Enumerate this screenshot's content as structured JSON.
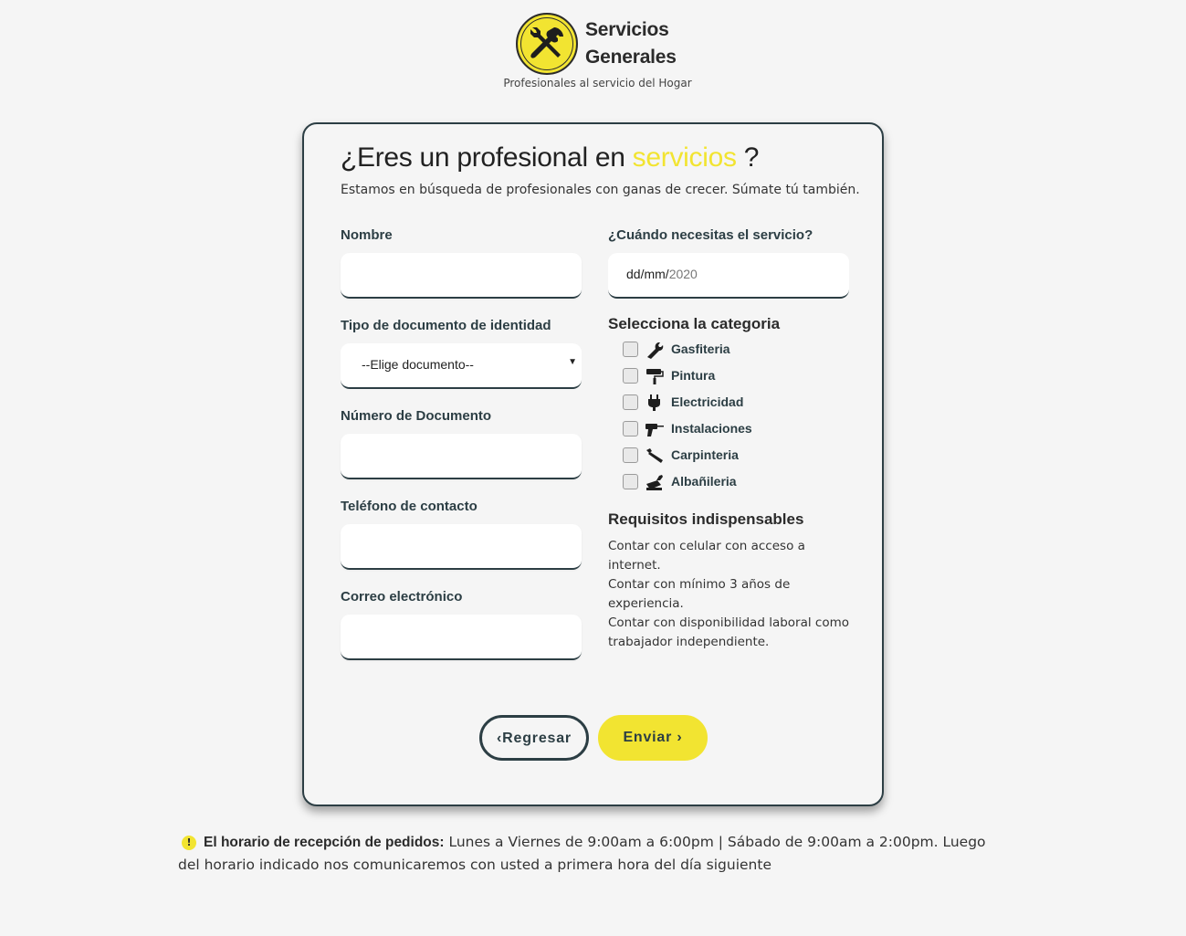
{
  "header": {
    "brand_line1": "Servicios",
    "brand_line2": "Generales",
    "tagline": "Profesionales al servicio del Hogar",
    "logo_icon": "tools-icon"
  },
  "form": {
    "title_prefix": "¿Eres un profesional en",
    "title_highlight": "servicios",
    "title_suffix": "?",
    "subtitle": "Estamos en búsqueda de profesionales con ganas de crecer. Súmate tú también.",
    "fields": {
      "nombre": {
        "label": "Nombre",
        "value": ""
      },
      "tipo_documento": {
        "label": "Tipo de documento de identidad",
        "selected": "--Elige documento--"
      },
      "numero_documento": {
        "label": "Número de Documento",
        "value": ""
      },
      "telefono": {
        "label": "Teléfono de contacto",
        "value": ""
      },
      "correo": {
        "label": "Correo electrónico",
        "value": ""
      },
      "fecha": {
        "label": "¿Cuándo necesitas el servicio?",
        "placeholder": "dd/mm/",
        "year": "2020"
      }
    },
    "categories_heading": "Selecciona la categoria",
    "categories": [
      {
        "label": "Gasfiteria",
        "icon": "wrench-icon",
        "checked": false
      },
      {
        "label": "Pintura",
        "icon": "paint-roller-icon",
        "checked": false
      },
      {
        "label": "Electricidad",
        "icon": "plug-icon",
        "checked": false
      },
      {
        "label": "Instalaciones",
        "icon": "drill-icon",
        "checked": false
      },
      {
        "label": "Carpinteria",
        "icon": "saw-icon",
        "checked": false
      },
      {
        "label": "Albañileria",
        "icon": "trowel-icon",
        "checked": false
      }
    ],
    "requirements_heading": "Requisitos indispensables",
    "requirements": [
      "Contar con celular con acceso a internet.",
      "Contar con mínimo 3 años de experiencia.",
      "Contar con disponibilidad laboral como trabajador independiente."
    ],
    "back_button": "Regresar",
    "send_button": "Enviar"
  },
  "notice": {
    "icon": "exclamation-icon",
    "bold": "El horario de recepción de pedidos:",
    "text": " Lunes a Viernes de 9:00am a 6:00pm | Sábado de 9:00am a 2:00pm. Luego del horario indicado nos comunicaremos con usted a primera hora del día siguiente"
  },
  "colors": {
    "accent": "#f2e431",
    "dark": "#2c3e44",
    "background": "#f5f5f5"
  }
}
